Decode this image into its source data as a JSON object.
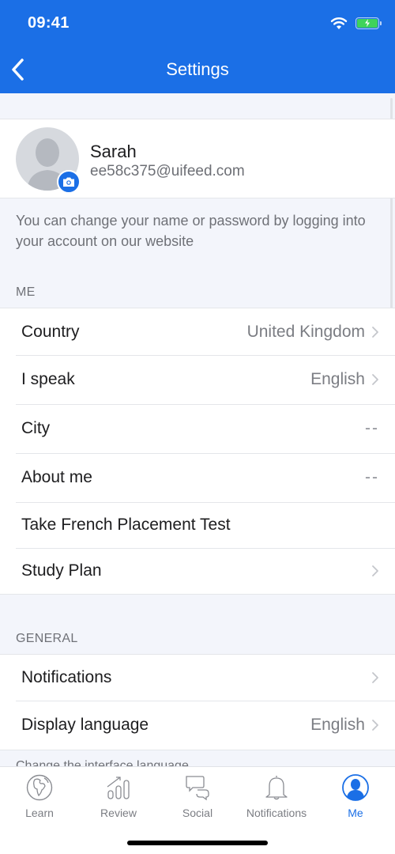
{
  "status_bar": {
    "time": "09:41",
    "wifi_icon": "wifi-icon",
    "battery_icon": "battery-charging-icon"
  },
  "nav": {
    "title": "Settings",
    "back_icon": "chevron-left-icon"
  },
  "colors": {
    "brand": "#1b6fe6",
    "background": "#f3f5fb",
    "battery_fill": "#3fd35a"
  },
  "profile": {
    "name": "Sarah",
    "email": "ee58c375@uifeed.com",
    "avatar_icon": "person-silhouette-icon",
    "camera_icon": "camera-icon"
  },
  "info_text": "You can change your name or password by logging into your account on our website",
  "sections": {
    "me": {
      "header": "ME",
      "rows": [
        {
          "label": "Country",
          "value": "United Kingdom",
          "chevron": true
        },
        {
          "label": "I speak",
          "value": "English",
          "chevron": true
        },
        {
          "label": "City",
          "value": "--",
          "chevron": false
        },
        {
          "label": "About me",
          "value": "--",
          "chevron": false
        },
        {
          "label": "Take French Placement Test",
          "value": "",
          "chevron": false
        },
        {
          "label": "Study Plan",
          "value": "",
          "chevron": true
        }
      ]
    },
    "general": {
      "header": "GENERAL",
      "rows": [
        {
          "label": "Notifications",
          "value": "",
          "chevron": true
        },
        {
          "label": "Display language",
          "value": "English",
          "chevron": true
        }
      ],
      "footer": "Change the interface language"
    }
  },
  "tabbar": {
    "tabs": [
      {
        "label": "Learn",
        "icon": "globe-icon",
        "active": false
      },
      {
        "label": "Review",
        "icon": "chart-bars-icon",
        "active": false
      },
      {
        "label": "Social",
        "icon": "chat-bubbles-icon",
        "active": false
      },
      {
        "label": "Notifications",
        "icon": "bell-icon",
        "active": false
      },
      {
        "label": "Me",
        "icon": "profile-icon",
        "active": true
      }
    ]
  }
}
